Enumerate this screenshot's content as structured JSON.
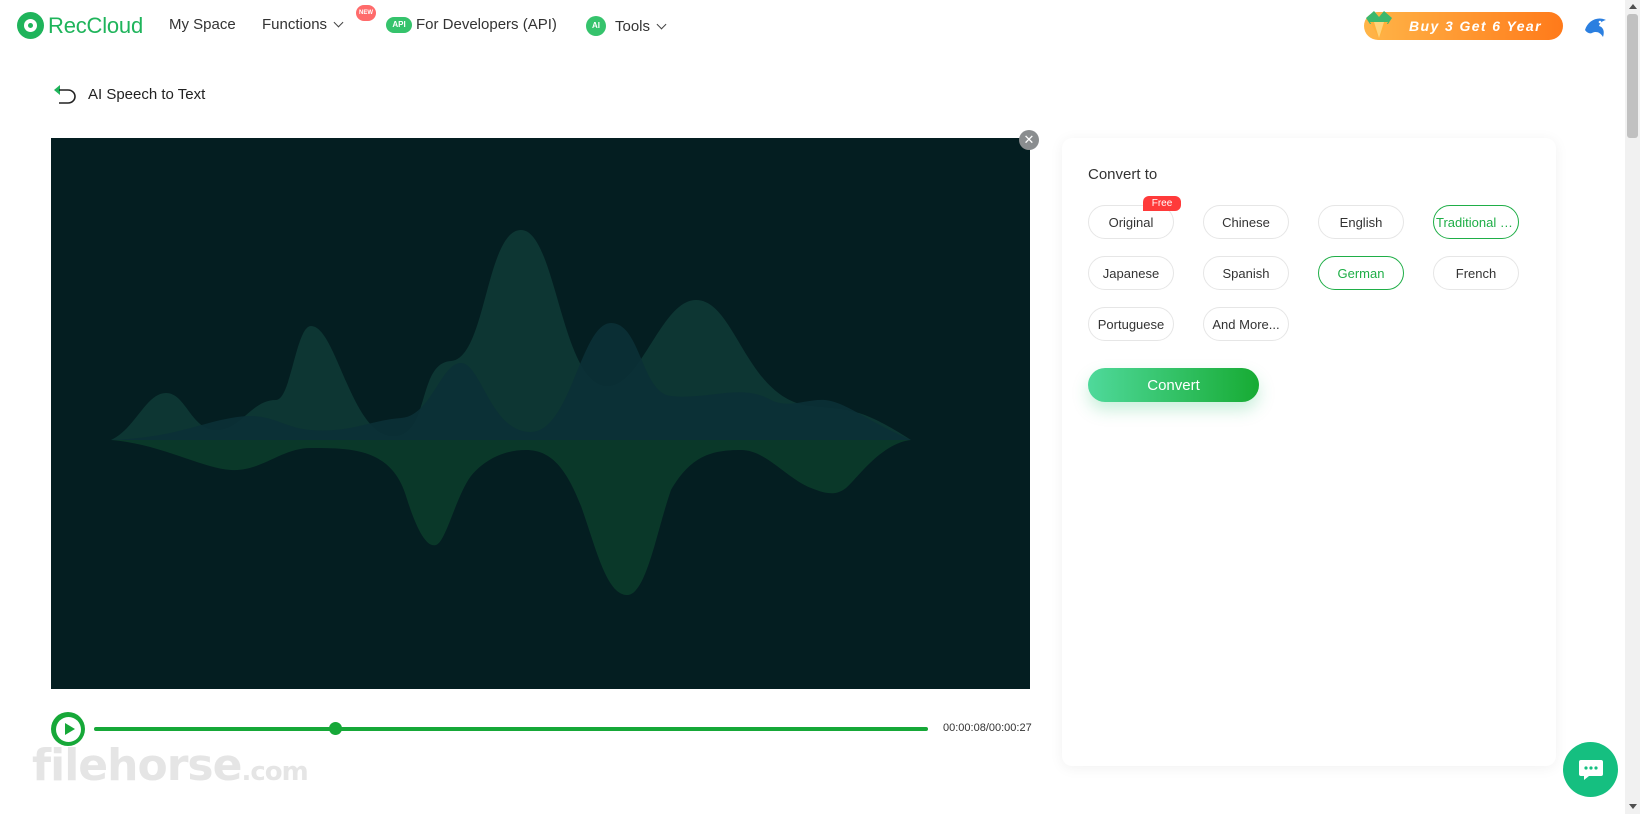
{
  "app": {
    "name": "RecCloud"
  },
  "nav": {
    "my_space": "My Space",
    "functions": "Functions",
    "functions_badge": "NEW",
    "developers_icon": "API",
    "developers": "For Developers (API)",
    "tools_icon": "AI",
    "tools": "Tools"
  },
  "promo": {
    "label": "Buy 3 Get 6 Year"
  },
  "page": {
    "back_title": "AI Speech to Text"
  },
  "player": {
    "current_time": "00:00:08",
    "total_time": "00:00:27",
    "time_label": "00:00:08/00:00:27",
    "progress": 0.29,
    "state": "paused"
  },
  "convert_panel": {
    "title": "Convert to",
    "free_badge": "Free",
    "options": [
      {
        "label": "Original",
        "selected": false
      },
      {
        "label": "Chinese",
        "selected": false
      },
      {
        "label": "English",
        "selected": false
      },
      {
        "label": "Traditional C...",
        "selected": true
      },
      {
        "label": "Japanese",
        "selected": false
      },
      {
        "label": "Spanish",
        "selected": false
      },
      {
        "label": "German",
        "selected": true
      },
      {
        "label": "French",
        "selected": false
      },
      {
        "label": "Portuguese",
        "selected": false
      },
      {
        "label": "And More...",
        "selected": false
      }
    ],
    "convert_label": "Convert"
  },
  "watermark": {
    "main": "filehorse",
    "suffix": ".com"
  },
  "colors": {
    "brand": "#1fb45b",
    "accent": "#16a838",
    "selected": "#1fae47",
    "player_bg": "#041e21",
    "promo": "#ff8a26"
  },
  "icons": {
    "back": "back-arrow-icon",
    "close": "close-icon",
    "play": "play-icon",
    "chat": "chat-icon",
    "avatar": "bird-avatar-icon"
  }
}
